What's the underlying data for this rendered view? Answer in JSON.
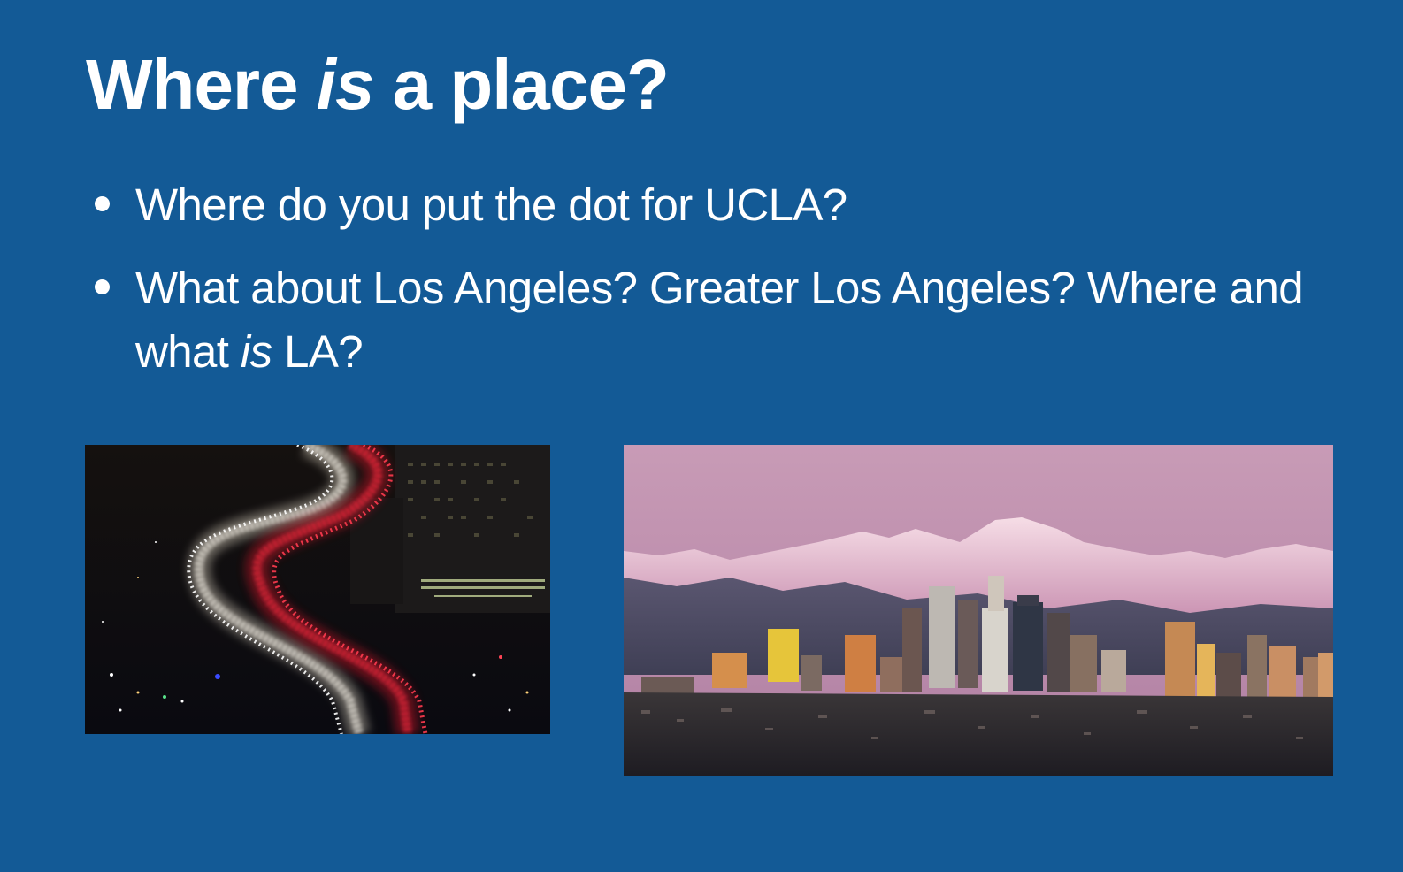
{
  "slide": {
    "title_before": "Where ",
    "title_italic": "is",
    "title_after": " a place?",
    "bullets": [
      {
        "text_before": "Where do you put the dot for UCLA?",
        "italic": "",
        "text_after": ""
      },
      {
        "text_before": "What about Los Angeles? Greater Los Angeles? Where and what ",
        "italic": "is",
        "text_after": " LA?"
      }
    ]
  },
  "images": [
    {
      "name": "night-freeway-traffic-photo"
    },
    {
      "name": "la-skyline-mountains-photo"
    }
  ],
  "colors": {
    "background": "#135a96",
    "text": "#ffffff"
  }
}
